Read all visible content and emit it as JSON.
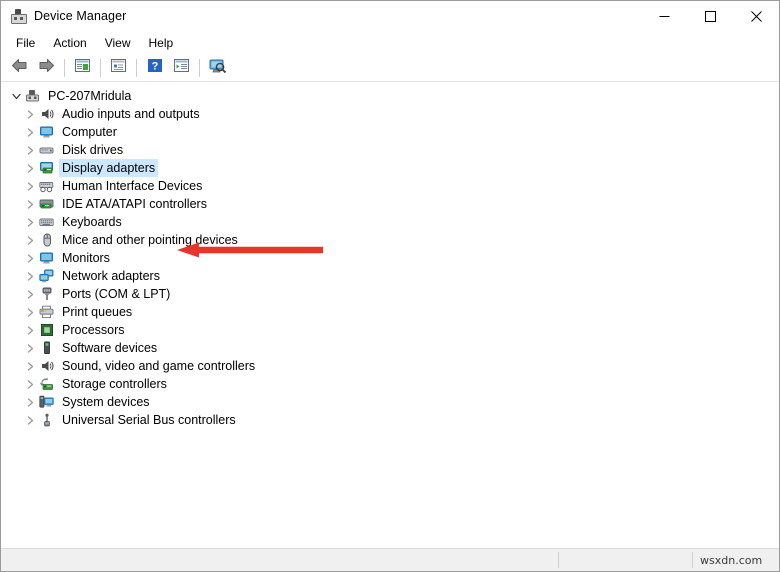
{
  "window": {
    "title": "Device Manager",
    "title_icon": "device-manager-icon",
    "controls": {
      "minimize": "Minimize",
      "maximize": "Maximize",
      "close": "Close"
    }
  },
  "menubar": {
    "items": [
      {
        "label": "File",
        "name": "menu-file"
      },
      {
        "label": "Action",
        "name": "menu-action"
      },
      {
        "label": "View",
        "name": "menu-view"
      },
      {
        "label": "Help",
        "name": "menu-help"
      }
    ]
  },
  "toolbar": {
    "buttons": [
      {
        "name": "back-button",
        "icon": "back-arrow-icon",
        "tooltip": "Back"
      },
      {
        "name": "forward-button",
        "icon": "forward-arrow-icon",
        "tooltip": "Forward"
      },
      {
        "name": "show-hide-console-tree-button",
        "icon": "console-tree-icon",
        "tooltip": "Show/Hide Console Tree"
      },
      {
        "name": "properties-button",
        "icon": "properties-icon",
        "tooltip": "Properties"
      },
      {
        "name": "help-button",
        "icon": "help-question-icon",
        "tooltip": "Help"
      },
      {
        "name": "update-driver-button",
        "icon": "update-driver-icon",
        "tooltip": "Update Driver Software"
      },
      {
        "name": "scan-hardware-changes-button",
        "icon": "scan-monitor-icon",
        "tooltip": "Scan for hardware changes"
      }
    ]
  },
  "tree": {
    "root": {
      "label": "PC-207Mridula",
      "icon": "computer-tower-icon",
      "expanded": true
    },
    "nodes": [
      {
        "label": "Audio inputs and outputs",
        "icon": "speaker-icon"
      },
      {
        "label": "Computer",
        "icon": "monitor-icon"
      },
      {
        "label": "Disk drives",
        "icon": "disk-drive-icon"
      },
      {
        "label": "Display adapters",
        "icon": "display-adapter-icon",
        "selected": true
      },
      {
        "label": "Human Interface Devices",
        "icon": "hid-icon"
      },
      {
        "label": "IDE ATA/ATAPI controllers",
        "icon": "ide-controller-icon"
      },
      {
        "label": "Keyboards",
        "icon": "keyboard-icon"
      },
      {
        "label": "Mice and other pointing devices",
        "icon": "mouse-icon"
      },
      {
        "label": "Monitors",
        "icon": "monitor-icon"
      },
      {
        "label": "Network adapters",
        "icon": "network-adapter-icon"
      },
      {
        "label": "Ports (COM & LPT)",
        "icon": "port-icon"
      },
      {
        "label": "Print queues",
        "icon": "printer-icon"
      },
      {
        "label": "Processors",
        "icon": "processor-icon"
      },
      {
        "label": "Software devices",
        "icon": "software-device-icon"
      },
      {
        "label": "Sound, video and game controllers",
        "icon": "speaker-icon"
      },
      {
        "label": "Storage controllers",
        "icon": "storage-controller-icon"
      },
      {
        "label": "System devices",
        "icon": "system-device-icon"
      },
      {
        "label": "Universal Serial Bus controllers",
        "icon": "usb-icon"
      }
    ]
  },
  "annotation": {
    "arrow_color": "#e8342a",
    "points_to": "Display adapters"
  },
  "statusbar": {
    "message": "",
    "panel2": "",
    "watermark": "wsxdn.com"
  },
  "colors": {
    "selection": "#cce8ff",
    "accent": "#0078d7",
    "arrow_red": "#e8342a",
    "statusbar_bg": "#f0f0f0"
  }
}
